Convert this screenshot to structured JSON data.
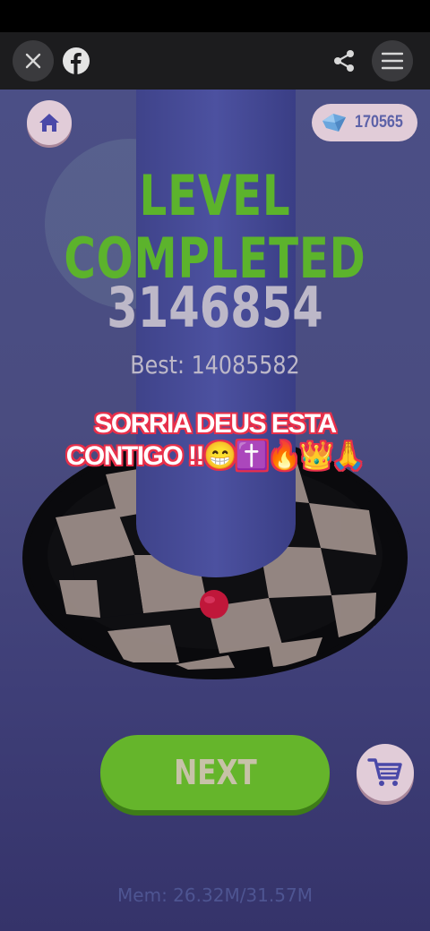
{
  "browser": {
    "close_icon": "close-icon",
    "facebook_icon": "facebook-icon",
    "share_icon": "share-icon",
    "menu_icon": "hamburger-menu-icon"
  },
  "game": {
    "gems": "170565",
    "title": "LEVEL COMPLETED",
    "score": "3146854",
    "best": "Best: 14085582",
    "caption": "SORRIA DEUS ESTA CONTIGO !!😁✝️🔥👑🙏",
    "next_label": "NEXT",
    "memory": "Mem: 26.32M/31.57M"
  },
  "colors": {
    "title_green": "#5cb32c",
    "button_green": "#65b52b",
    "caption_outline": "#e8304a",
    "ball_red": "#c0173a",
    "badge_pink": "#e1ccd8"
  }
}
